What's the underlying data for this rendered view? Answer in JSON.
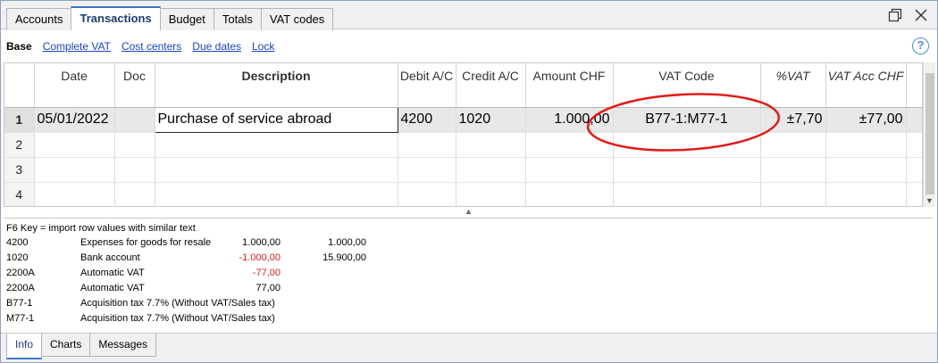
{
  "tabs": [
    "Accounts",
    "Transactions",
    "Budget",
    "Totals",
    "VAT codes"
  ],
  "active_tab": "Transactions",
  "subnav": {
    "base": "Base",
    "links": [
      "Complete VAT",
      "Cost centers",
      "Due dates",
      "Lock"
    ]
  },
  "icons": {
    "restore": "restore-window-icon",
    "close": "close-icon",
    "help": "help-icon"
  },
  "help_glyph": "?",
  "grid": {
    "columns": [
      "",
      "Date",
      "Doc",
      "Description",
      "Debit A/C",
      "Credit A/C",
      "Amount CHF",
      "VAT Code",
      "%VAT",
      "VAT Acc CHF"
    ],
    "rows": [
      {
        "num": "1",
        "date": "05/01/2022",
        "doc": "",
        "description": "Purchase of service abroad",
        "debit": "4200",
        "credit": "1020",
        "amount": "1.000,00",
        "vat_code": "B77-1:M77-1",
        "vat_pct": "±7,70",
        "vat_acc": "±77,00"
      },
      {
        "num": "2",
        "date": "",
        "doc": "",
        "description": "",
        "debit": "",
        "credit": "",
        "amount": "",
        "vat_code": "",
        "vat_pct": "",
        "vat_acc": ""
      },
      {
        "num": "3",
        "date": "",
        "doc": "",
        "description": "",
        "debit": "",
        "credit": "",
        "amount": "",
        "vat_code": "",
        "vat_pct": "",
        "vat_acc": ""
      },
      {
        "num": "4",
        "date": "",
        "doc": "",
        "description": "",
        "debit": "",
        "credit": "",
        "amount": "",
        "vat_code": "",
        "vat_pct": "",
        "vat_acc": ""
      }
    ]
  },
  "info": {
    "hint": "F6 Key = import row values with similar text",
    "lines": [
      {
        "account": "4200",
        "description": "Expenses for goods for resale",
        "amount": "1.000,00",
        "balance": "1.000,00"
      },
      {
        "account": "1020",
        "description": "Bank account",
        "amount": "-1.000,00",
        "balance": "15.900,00"
      },
      {
        "account": "2200A",
        "description": "Automatic VAT",
        "amount": "-77,00",
        "balance": ""
      },
      {
        "account": "2200A",
        "description": "Automatic VAT",
        "amount": "77,00",
        "balance": ""
      },
      {
        "account": "B77-1",
        "description": "Acquisition tax 7.7% (Without VAT/Sales tax)",
        "amount": "",
        "balance": ""
      },
      {
        "account": "M77-1",
        "description": "Acquisition tax 7.7% (Without VAT/Sales tax)",
        "amount": "",
        "balance": ""
      }
    ]
  },
  "bottom_tabs": [
    "Info",
    "Charts",
    "Messages"
  ],
  "active_bottom_tab": "Info",
  "colors": {
    "annotation": "#e01c1c",
    "link": "#1a44c0",
    "negative": "#e01c1c"
  }
}
